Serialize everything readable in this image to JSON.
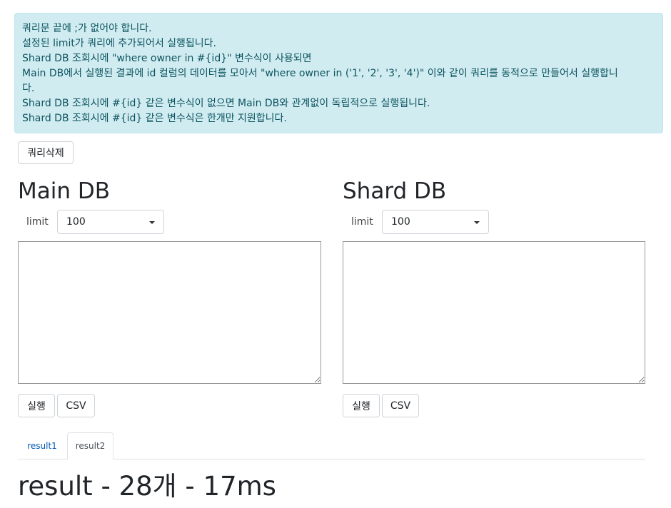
{
  "notice": {
    "lines": [
      "쿼리문 끝에 ;가 없어야 합니다.",
      "설정된 limit가 쿼리에 추가되어서 실행됩니다.",
      "Shard DB 조회시에 \"where owner in #{id}\" 변수식이 사용되면",
      "Main DB에서 실행된 결과에 id 컬럼의 데이터를 모아서 \"where owner in ('1', '2', '3', '4')\" 이와 같이 쿼리를 동적으로 만들어서 실행합니",
      "다.",
      "Shard DB 조회시에 #{id} 같은 변수식이 없으면 Main DB와 관계없이 독립적으로 실행됩니다.",
      "Shard DB 조회시에 #{id} 같은 변수식은 한개만 지원합니다."
    ]
  },
  "delete_button": "쿼리삭제",
  "main_db": {
    "title": "Main DB",
    "limit_label": "limit",
    "limit_value": "100",
    "run_label": "실행",
    "csv_label": "CSV",
    "query": ""
  },
  "shard_db": {
    "title": "Shard DB",
    "limit_label": "limit",
    "limit_value": "100",
    "run_label": "실행",
    "csv_label": "CSV",
    "query": ""
  },
  "tabs": [
    {
      "label": "result1",
      "active": false
    },
    {
      "label": "result2",
      "active": true
    }
  ],
  "result": {
    "heading": "result - 28개 - 17ms"
  }
}
